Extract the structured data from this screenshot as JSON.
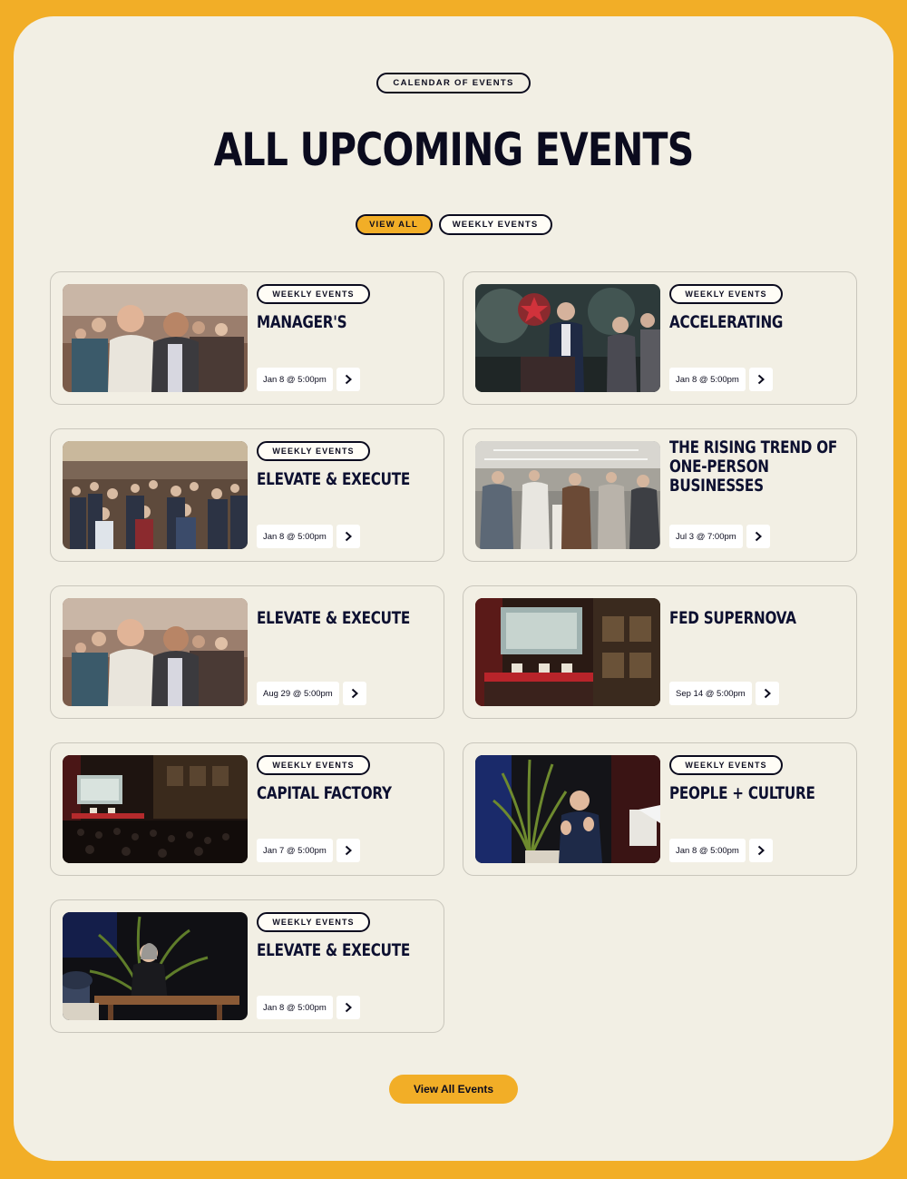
{
  "section": {
    "eyebrow": "CALENDAR OF EVENTS",
    "title": "ALL UPCOMING EVENTS",
    "filters": [
      {
        "label": "VIEW ALL",
        "active": true
      },
      {
        "label": "WEEKLY EVENTS",
        "active": false
      }
    ],
    "cta_label": "View All Events"
  },
  "events": [
    {
      "tag": "WEEKLY EVENTS",
      "title": "MANAGER'S",
      "date": "Jan 8 @ 5:00pm",
      "photo": "networking-crowd"
    },
    {
      "tag": "WEEKLY EVENTS",
      "title": "ACCELERATING",
      "date": "Jan 8 @ 5:00pm",
      "photo": "podium-speaker"
    },
    {
      "tag": "WEEKLY EVENTS",
      "title": "ELEVATE & EXECUTE",
      "date": "Jan 8 @ 5:00pm",
      "photo": "ballroom-crowd"
    },
    {
      "tag": "",
      "title": "THE RISING TREND OF ONE-PERSON BUSINESSES",
      "date": "Jul 3 @ 7:00pm",
      "photo": "mingling-group"
    },
    {
      "tag": "",
      "title": "ELEVATE & EXECUTE",
      "date": "Aug 29 @ 5:00pm",
      "photo": "networking-crowd"
    },
    {
      "tag": "",
      "title": "FED SUPERNOVA",
      "date": "Sep 14 @ 5:00pm",
      "photo": "theater-stage"
    },
    {
      "tag": "WEEKLY EVENTS",
      "title": "CAPITAL FACTORY",
      "date": "Jan 7 @ 5:00pm",
      "photo": "theater-audience"
    },
    {
      "tag": "WEEKLY EVENTS",
      "title": "PEOPLE + CULTURE",
      "date": "Jan 8 @ 5:00pm",
      "photo": "stage-speaker"
    },
    {
      "tag": "WEEKLY EVENTS",
      "title": "ELEVATE & EXECUTE",
      "date": "Jan 8 @ 5:00pm",
      "photo": "stage-panel"
    }
  ],
  "colors": {
    "background": "#f2ae27",
    "panel": "#f2efe4",
    "ink": "#0b0b1e",
    "accent": "#f2ae27"
  }
}
